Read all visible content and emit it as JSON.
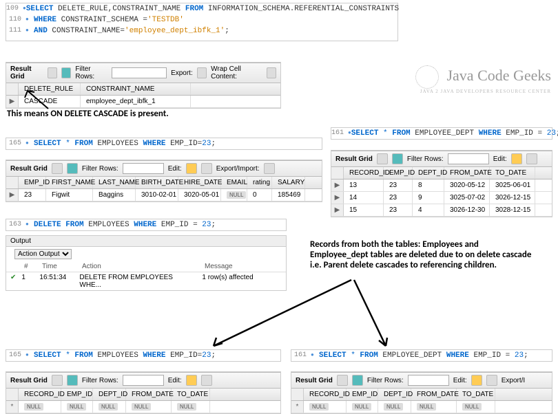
{
  "top_sql": {
    "lines": [
      {
        "num": "109",
        "parts": [
          [
            "kw",
            "SELECT"
          ],
          [
            "ident",
            " DELETE_RULE,CONSTRAINT_NAME "
          ],
          [
            "kw",
            "FROM"
          ],
          [
            "ident",
            " INFORMATION_SCHEMA.REFERENTIAL_CONSTRAINTS"
          ]
        ]
      },
      {
        "num": "110",
        "parts": [
          [
            "kw",
            "WHERE"
          ],
          [
            "ident",
            " CONSTRAINT_SCHEMA ="
          ],
          [
            "str",
            "'TESTDB'"
          ]
        ]
      },
      {
        "num": "111",
        "parts": [
          [
            "kw",
            "AND"
          ],
          [
            "ident",
            " CONSTRAINT_NAME="
          ],
          [
            "str",
            "'employee_dept_ibfk_1'"
          ],
          [
            "ident",
            ";"
          ]
        ]
      }
    ]
  },
  "result_bar": {
    "label": "Result Grid",
    "filter_label": "Filter Rows:",
    "export_label": "Export:",
    "wrap_label": "Wrap Cell Content:",
    "edit_label": "Edit:",
    "export_import_label": "Export/Import:",
    "exporti_label": "Export/I"
  },
  "grid1": {
    "headers": [
      "DELETE_RULE",
      "CONSTRAINT_NAME"
    ],
    "rows": [
      [
        "CASCADE",
        "employee_dept_ibfk_1"
      ]
    ]
  },
  "ann1": "This means ON DELETE CASCADE is present.",
  "sql_emp_select_165": {
    "num": "165",
    "parts": [
      [
        "kw",
        "SELECT"
      ],
      [
        "star",
        " * "
      ],
      [
        "kw",
        "FROM"
      ],
      [
        "ident",
        " EMPLOYEES "
      ],
      [
        "kw",
        "WHERE"
      ],
      [
        "ident",
        " EMP_ID="
      ],
      [
        "num",
        "23"
      ],
      [
        "ident",
        ";"
      ]
    ]
  },
  "sql_deptsel_161": {
    "num": "161",
    "parts": [
      [
        "kw",
        "SELECT"
      ],
      [
        "star",
        " * "
      ],
      [
        "kw",
        "FROM"
      ],
      [
        "ident",
        " EMPLOYEE_DEPT "
      ],
      [
        "kw",
        "WHERE"
      ],
      [
        "ident",
        " EMP_ID = "
      ],
      [
        "num",
        "23"
      ],
      [
        "ident",
        ";"
      ]
    ]
  },
  "grid_emp": {
    "headers": [
      "EMP_ID",
      "FIRST_NAME",
      "LAST_NAME",
      "BIRTH_DATE",
      "HIRE_DATE",
      "EMAIL",
      "rating",
      "SALARY"
    ],
    "rows": [
      [
        "23",
        "Figwit",
        "Baggins",
        "3010-02-01",
        "3020-05-01",
        "NULL",
        "0",
        "185469"
      ]
    ]
  },
  "grid_dept": {
    "headers": [
      "RECORD_ID",
      "EMP_ID",
      "DEPT_ID",
      "FROM_DATE",
      "TO_DATE"
    ],
    "rows": [
      [
        "13",
        "23",
        "8",
        "3020-05-12",
        "3025-06-01"
      ],
      [
        "14",
        "23",
        "9",
        "3025-07-02",
        "3026-12-15"
      ],
      [
        "15",
        "23",
        "4",
        "3026-12-30",
        "3028-12-15"
      ]
    ]
  },
  "sql_delete_163": {
    "num": "163",
    "parts": [
      [
        "kw",
        "DELETE"
      ],
      [
        "kw",
        " FROM"
      ],
      [
        "ident",
        " EMPLOYEES "
      ],
      [
        "kw",
        "WHERE"
      ],
      [
        "ident",
        " EMP_ID = "
      ],
      [
        "num",
        "23"
      ],
      [
        "ident",
        ";"
      ]
    ]
  },
  "output": {
    "title": "Output",
    "dropdown": "Action Output",
    "headers": [
      "#",
      "Time",
      "Action",
      "Message"
    ],
    "row": {
      "idx": "1",
      "time": "16:51:34",
      "action": "DELETE FROM EMPLOYEES WHE...",
      "message": "1 row(s) affected"
    }
  },
  "ann2": "Records from both the tables: Employees and Employee_dept tables are deleted due to on delete cascade i.e. Parent delete cascades to referencing children.",
  "grid_empty": {
    "headers": [
      "RECORD_ID",
      "EMP_ID",
      "DEPT_ID",
      "FROM_DATE",
      "TO_DATE"
    ],
    "null_row": [
      "NULL",
      "NULL",
      "NULL",
      "NULL",
      "NULL"
    ]
  },
  "logo": {
    "main": "Java Code Geeks",
    "sub": "JAVA 2 JAVA DEVELOPERS RESOURCE CENTER"
  }
}
